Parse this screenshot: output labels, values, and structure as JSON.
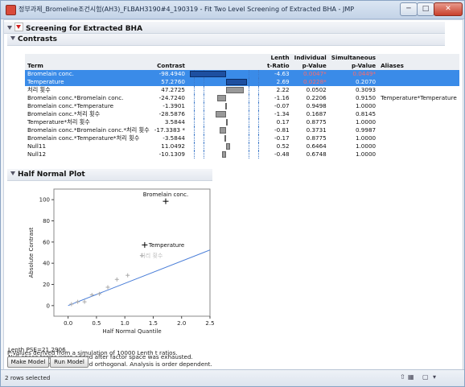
{
  "window": {
    "title": "정부과제_Bromeline조건시험(AH3)_FLBAH3190#4_190319 - Fit Two Level Screening of Extracted BHA - JMP",
    "min_glyph": "─",
    "max_glyph": "□",
    "close_glyph": "✕"
  },
  "report": {
    "title": "Screening for Extracted BHA"
  },
  "contrasts": {
    "title": "Contrasts",
    "headers": {
      "term": "Term",
      "contrast": "Contrast",
      "lenth_1": "Lenth",
      "lenth_2": "t-Ratio",
      "ind_1": "Individual",
      "ind_2": "p-Value",
      "sim_1": "Simultaneous",
      "sim_2": "p-Value",
      "aliases": "Aliases"
    },
    "rows": [
      {
        "term": "Bromelain conc.",
        "contrast": "-98.4940",
        "lenth": "-4.63",
        "ind_p": "0.0047*",
        "sim_p": "0.0449*",
        "aliases": "",
        "selected": true,
        "bar": -98.494
      },
      {
        "term": "Temperature",
        "contrast": "57.2760",
        "lenth": "2.69",
        "ind_p": "0.0228*",
        "sim_p": "0.2070",
        "aliases": "",
        "selected": true,
        "bar": 57.276
      },
      {
        "term": "처리 횟수",
        "contrast": "47.2725",
        "lenth": "2.22",
        "ind_p": "0.0502",
        "sim_p": "0.3093",
        "aliases": "",
        "selected": false,
        "bar": 47.2725
      },
      {
        "term": "Bromelain conc.*Bromelain conc.",
        "contrast": "-24.7240",
        "lenth": "-1.16",
        "ind_p": "0.2206",
        "sim_p": "0.9150",
        "aliases": "Temperature*Temperature",
        "selected": false,
        "bar": -24.724
      },
      {
        "term": "Bromelain conc.*Temperature",
        "contrast": "-1.3901",
        "lenth": "-0.07",
        "ind_p": "0.9498",
        "sim_p": "1.0000",
        "aliases": "",
        "selected": false,
        "bar": -1.3901
      },
      {
        "term": "Bromelain conc.*처리 횟수",
        "contrast": "-28.5876",
        "lenth": "-1.34",
        "ind_p": "0.1687",
        "sim_p": "0.8145",
        "aliases": "",
        "selected": false,
        "bar": -28.5876
      },
      {
        "term": "Temperature*처리 횟수",
        "contrast": "3.5844",
        "lenth": "0.17",
        "ind_p": "0.8775",
        "sim_p": "1.0000",
        "aliases": "",
        "selected": false,
        "bar": 3.5844
      },
      {
        "term": "Bromelain conc.*Bromelain conc.*처리 횟수",
        "contrast": "-17.3383 *",
        "lenth": "-0.81",
        "ind_p": "0.3731",
        "sim_p": "0.9987",
        "aliases": "",
        "selected": false,
        "bar": -17.3383
      },
      {
        "term": "Bromelain conc.*Temperature*처리 횟수",
        "contrast": "-3.5844",
        "lenth": "-0.17",
        "ind_p": "0.8775",
        "sim_p": "1.0000",
        "aliases": "",
        "selected": false,
        "bar": -3.5844
      },
      {
        "term": "Null11",
        "contrast": "11.0492",
        "lenth": "0.52",
        "ind_p": "0.6464",
        "sim_p": "1.0000",
        "aliases": "",
        "selected": false,
        "bar": 11.0492
      },
      {
        "term": "Null12",
        "contrast": "-10.1309",
        "lenth": "-0.48",
        "ind_p": "0.6748",
        "sim_p": "1.0000",
        "aliases": "",
        "selected": false,
        "bar": -10.1309
      }
    ]
  },
  "half_normal": {
    "title": "Half Normal Plot"
  },
  "chart_data": {
    "type": "scatter",
    "xlabel": "Half Normal Quantile",
    "ylabel": "Absolute Contrast",
    "xlim": [
      -0.25,
      2.5
    ],
    "ylim": [
      -10,
      110
    ],
    "xticks": [
      "0.0",
      "0.5",
      "1.0",
      "1.5",
      "2.0",
      "2.5"
    ],
    "yticks": [
      "0",
      "20",
      "40",
      "60",
      "80",
      "100"
    ],
    "points": [
      {
        "x": 0.06,
        "y": 1.39
      },
      {
        "x": 0.17,
        "y": 3.58
      },
      {
        "x": 0.29,
        "y": 3.58
      },
      {
        "x": 0.42,
        "y": 10.13
      },
      {
        "x": 0.55,
        "y": 11.05
      },
      {
        "x": 0.7,
        "y": 17.34
      },
      {
        "x": 0.86,
        "y": 24.72
      },
      {
        "x": 1.05,
        "y": 28.59
      },
      {
        "x": 1.3,
        "y": 47.27
      },
      {
        "x": 1.35,
        "y": 57.28
      },
      {
        "x": 1.72,
        "y": 98.49
      }
    ],
    "point_labels": [
      {
        "index": 10,
        "text": "Bromelain conc."
      },
      {
        "index": 9,
        "text": "Temperature"
      },
      {
        "index": 8,
        "text": "처리 횟수"
      }
    ],
    "reference_line": {
      "x": [
        0,
        2.5
      ],
      "y": [
        0,
        52.5
      ]
    }
  },
  "notes": {
    "lenth_pse": "Lenth PSE=21.2906",
    "line1": "Null-space terms were added after factor space was exhausted.",
    "line2": "Asterisked terms were forced orthogonal. Analysis is order dependent.",
    "line3": "P-Values derived from a simulation of 10000 Lenth t ratios."
  },
  "buttons": {
    "make_model": "Make Model",
    "run_model": "Run Model"
  },
  "status": {
    "text": "2 rows selected"
  }
}
